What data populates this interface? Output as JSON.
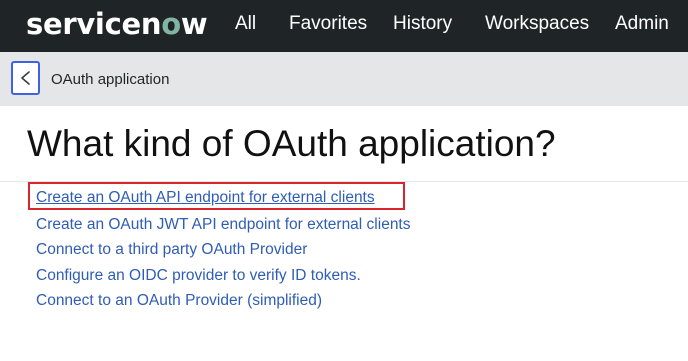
{
  "header": {
    "logo_prefix": "servicen",
    "logo_accent": "o",
    "logo_suffix": "w",
    "nav": [
      "All",
      "Favorites",
      "History",
      "Workspaces",
      "Admin"
    ]
  },
  "subheader": {
    "back_icon": "chevron-left-icon",
    "title": "OAuth application"
  },
  "main": {
    "heading": "What kind of OAuth application?",
    "options": [
      "Create an OAuth API endpoint for external clients",
      "Create an OAuth JWT API endpoint for external clients",
      "Connect to a third party OAuth Provider",
      "Configure an OIDC provider to verify ID tokens.",
      "Connect to an OAuth Provider (simplified)"
    ],
    "highlighted_option_index": 0
  },
  "colors": {
    "topbar_bg": "#1f2527",
    "logo_accent": "#81b5a1",
    "subheader_bg": "#e4e6e7",
    "link": "#2f5db5",
    "back_button_border": "#3f63e0",
    "highlight_border": "#d9262d"
  }
}
